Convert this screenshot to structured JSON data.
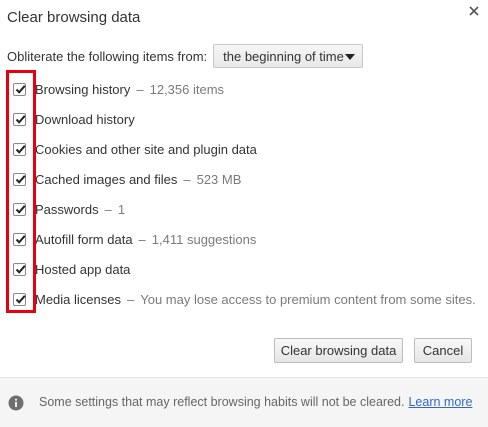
{
  "dialog": {
    "title": "Clear browsing data",
    "close_icon": "close-icon"
  },
  "range": {
    "label": "Obliterate the following items from:",
    "selected": "the beginning of time"
  },
  "items": [
    {
      "label": "Browsing history",
      "detail": "12,356 items",
      "checked": true
    },
    {
      "label": "Download history",
      "detail": "",
      "checked": true
    },
    {
      "label": "Cookies and other site and plugin data",
      "detail": "",
      "checked": true
    },
    {
      "label": "Cached images and files",
      "detail": "523 MB",
      "checked": true
    },
    {
      "label": "Passwords",
      "detail": "1",
      "checked": true
    },
    {
      "label": "Autofill form data",
      "detail": "1,411 suggestions",
      "checked": true
    },
    {
      "label": "Hosted app data",
      "detail": "",
      "checked": true
    },
    {
      "label": "Media licenses",
      "detail": "You may lose access to premium content from some sites.",
      "checked": true
    }
  ],
  "detail_separator": "–",
  "buttons": {
    "clear": "Clear browsing data",
    "cancel": "Cancel"
  },
  "footer": {
    "text": "Some settings that may reflect browsing habits will not be cleared.",
    "link": "Learn more"
  },
  "colors": {
    "highlight_border": "#e8000f",
    "link": "#3366cc"
  }
}
